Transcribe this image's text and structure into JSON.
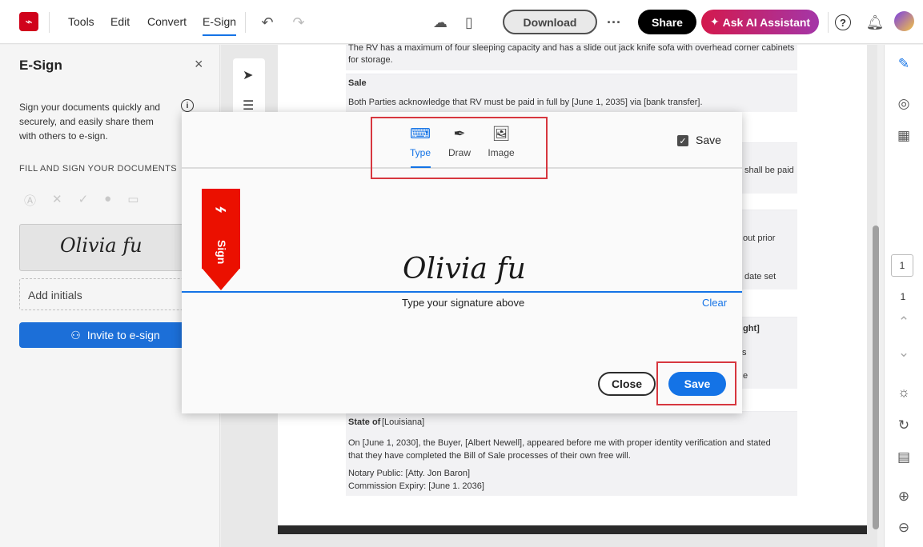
{
  "topbar": {
    "menu": [
      "Tools",
      "Edit",
      "Convert",
      "E-Sign"
    ],
    "download_label": "Download",
    "more_label": "···",
    "share_label": "Share",
    "ai_label": "Ask AI Assistant",
    "help_label": "?"
  },
  "left_panel": {
    "title": "E-Sign",
    "description": "Sign your documents quickly and securely, and easily share them with others to e-sign.",
    "section_label": "FILL AND SIGN YOUR DOCUMENTS",
    "signature_preview": "Olivia fu",
    "initials_label": "Add initials",
    "invite_label": "Invite to e-sign"
  },
  "document": {
    "lines": [
      "The RV has a maximum of four sleeping capacity and has a slide out jack knife sofa with overhead corner cabinets",
      "for storage.",
      "Sale",
      "Both Parties acknowledge that RV must be paid in full by [June 1, 2035] via [bank transfer].",
      "shall be paid",
      "out prior",
      "date set",
      "ght]",
      "s",
      "e",
      "State of",
      "[Louisiana]",
      "On [June 1, 2030], the Buyer, [Albert Newell], appeared before me with proper identity verification and stated",
      "that they have completed the Bill of Sale processes of their own free will.",
      "Notary Public: [Atty. Jon Baron]",
      "Commission Expiry: [June 1. 2036]"
    ]
  },
  "right_rail": {
    "page_current": "1",
    "page_total": "1"
  },
  "modal": {
    "tabs": [
      "Type",
      "Draw",
      "Image"
    ],
    "save_checkbox_label": "Save",
    "ribbon_text": "Sign",
    "signature_text": "Olivia fu",
    "hint": "Type your signature above",
    "clear_label": "Clear",
    "close_label": "Close",
    "save_label": "Save"
  },
  "colors": {
    "accent": "#1473e6",
    "brand_red": "#eb1000",
    "highlight": "#d7373f"
  }
}
